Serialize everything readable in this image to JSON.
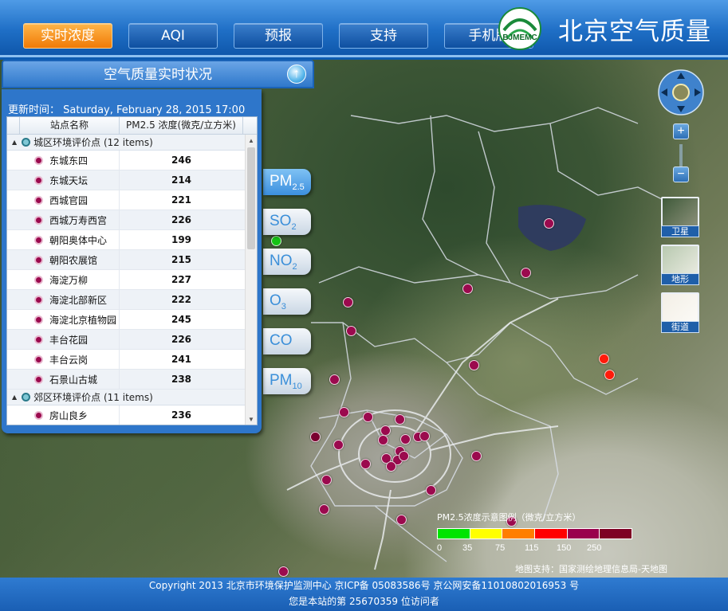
{
  "nav": {
    "tabs": [
      {
        "label": "实时浓度",
        "active": true
      },
      {
        "label": "AQI"
      },
      {
        "label": "预报"
      },
      {
        "label": "支持"
      },
      {
        "label": "手机版"
      }
    ]
  },
  "brand": {
    "logo_text": "BJMEMC",
    "site_title": "北京空气质量"
  },
  "panel": {
    "title": "空气质量实时状况",
    "update_label": "更新时间：",
    "update_time": "Saturday, February 28, 2015 17:00",
    "columns": {
      "name": "站点名称",
      "value": "PM2.5 浓度(微克/立方米)"
    },
    "groups": [
      {
        "label": "城区环境评价点 (12 items)",
        "rows": [
          {
            "name": "东城东四",
            "value": "246"
          },
          {
            "name": "东城天坛",
            "value": "214"
          },
          {
            "name": "西城官园",
            "value": "221"
          },
          {
            "name": "西城万寿西宫",
            "value": "226"
          },
          {
            "name": "朝阳奥体中心",
            "value": "199"
          },
          {
            "name": "朝阳农展馆",
            "value": "215"
          },
          {
            "name": "海淀万柳",
            "value": "227"
          },
          {
            "name": "海淀北部新区",
            "value": "222"
          },
          {
            "name": "海淀北京植物园",
            "value": "245"
          },
          {
            "name": "丰台花园",
            "value": "226"
          },
          {
            "name": "丰台云岗",
            "value": "241"
          },
          {
            "name": "石景山古城",
            "value": "238"
          }
        ]
      },
      {
        "label": "郊区环境评价点 (11 items)",
        "rows": [
          {
            "name": "房山良乡",
            "value": "236"
          }
        ]
      }
    ]
  },
  "pollutants": [
    {
      "main": "PM",
      "sub": "2.5",
      "active": true
    },
    {
      "main": "SO",
      "sub": "2"
    },
    {
      "main": "NO",
      "sub": "2"
    },
    {
      "main": "O",
      "sub": "3"
    },
    {
      "main": "CO",
      "sub": ""
    },
    {
      "main": "PM",
      "sub": "10"
    }
  ],
  "map_types": [
    {
      "label": "卫星"
    },
    {
      "label": "地形"
    },
    {
      "label": "街道"
    }
  ],
  "legend": {
    "title": "PM2.5浓度示意图例（微克/立方米）",
    "colors": [
      "#00e400",
      "#ffff00",
      "#ff7e00",
      "#ff0000",
      "#99004c",
      "#7e0023"
    ],
    "ticks": [
      "0",
      "35",
      "75",
      "115",
      "150",
      "250"
    ]
  },
  "map_credit": "地图支持：国家测绘地理信息局-天地图",
  "footer": {
    "line1": "Copyright 2013 北京市环境保护监测中心    京ICP备 05083586号    京公网安备11010802016953 号",
    "line2": "您是本站的第 25670359 位访问者"
  }
}
